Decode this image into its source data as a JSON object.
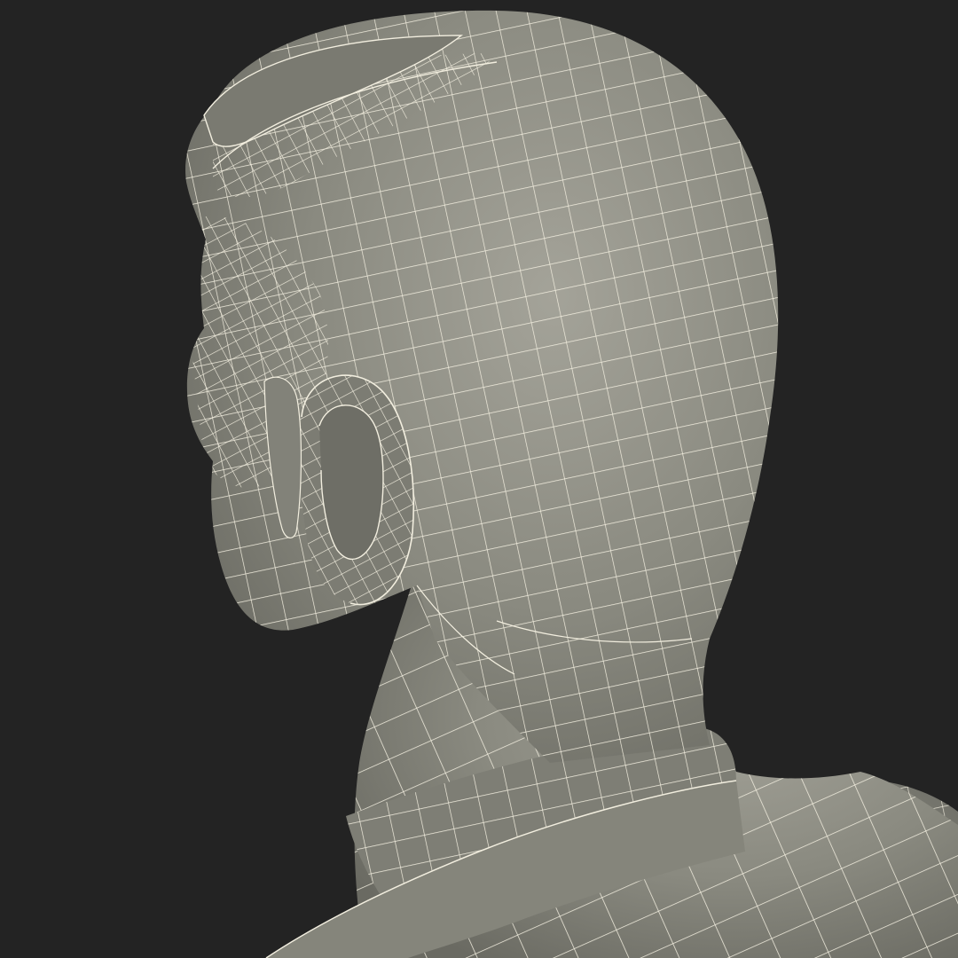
{
  "render": {
    "background_color": "#232323",
    "mesh_fill_color": "#8a8a80",
    "mesh_shadow_color": "#6f6f66",
    "mesh_highlight_color": "#a09f95",
    "wire_color": "#f2eedf"
  }
}
